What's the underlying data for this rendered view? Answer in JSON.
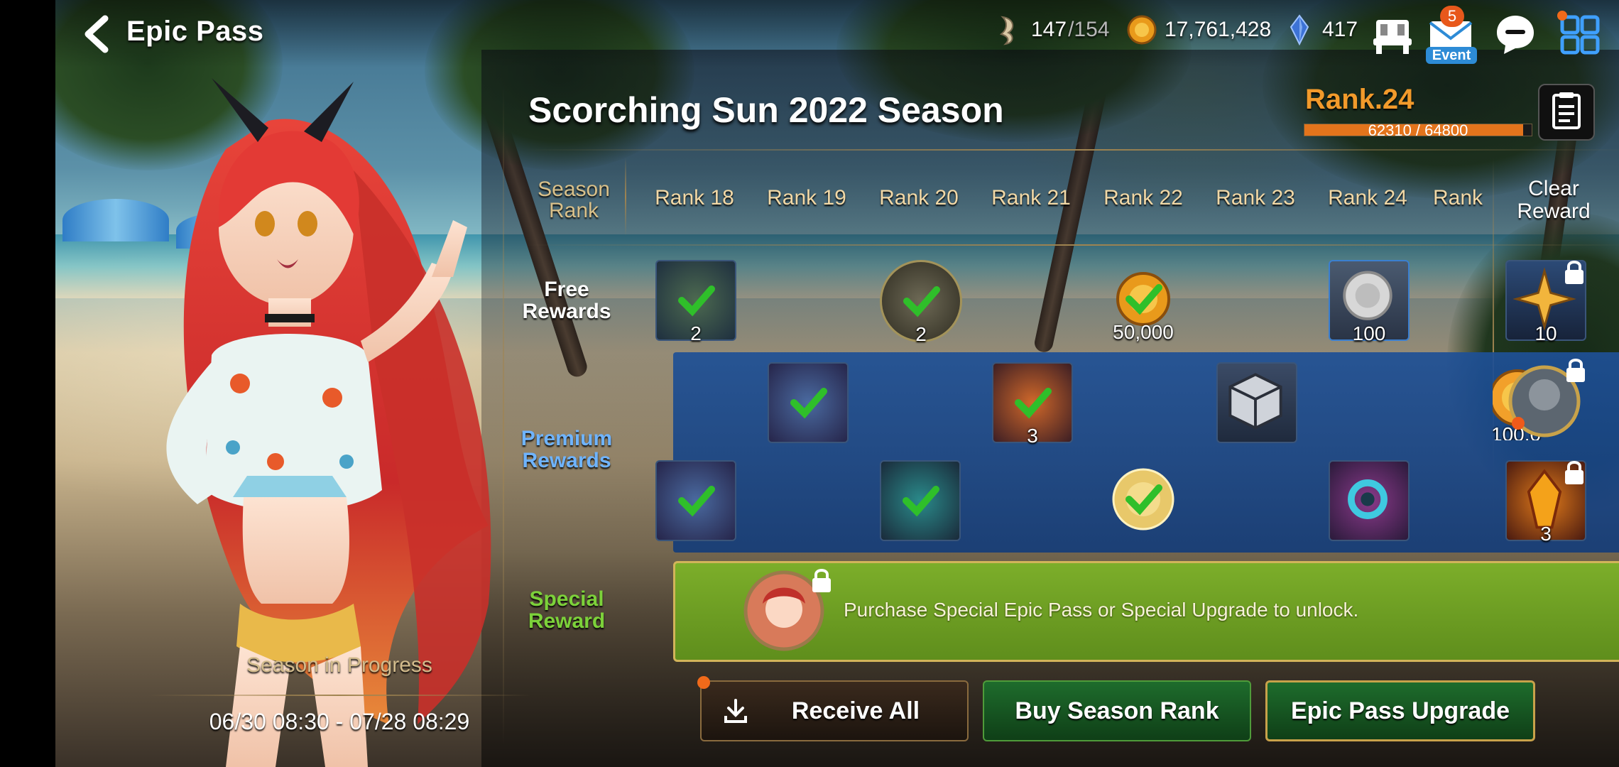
{
  "window": {
    "title": "Epic Pass"
  },
  "currencies": {
    "stamina_current": "147",
    "stamina_max": "/154",
    "gold": "17,761,428",
    "crystals": "417"
  },
  "topbar": {
    "event_badge": "5",
    "event_label": "Event"
  },
  "season": {
    "title": "Scorching Sun 2022 Season",
    "rank_label": "Rank.24",
    "rank_progress_text": "62310 / 64800",
    "rank_progress": 0.9616,
    "status": "Season in Progress",
    "dates": "06/30 08:30 - 07/28 08:29"
  },
  "table": {
    "season_rank_header": "Season Rank",
    "clear_reward_header": "Clear Reward",
    "ranks": [
      "Rank 18",
      "Rank 19",
      "Rank 20",
      "Rank 21",
      "Rank 22",
      "Rank 23",
      "Rank 24",
      "Rank"
    ],
    "free_label": "Free Rewards",
    "premium_label": "Premium Rewards",
    "special_label": "Special Reward",
    "free_counts": {
      "r18": "2",
      "r20": "2",
      "r22": "50,000",
      "r24": "100",
      "clear": "10"
    },
    "premium_counts": {
      "r21": "3",
      "r25": "100,0",
      "clear": "3"
    },
    "special_message": "Purchase Special Epic Pass or Special Upgrade to unlock."
  },
  "buttons": {
    "receive_all": "Receive All",
    "buy_season_rank": "Buy Season Rank",
    "epic_pass_upgrade": "Epic Pass Upgrade"
  },
  "colors": {
    "accent_orange": "#f29a2b",
    "premium_blue": "#6fb4ff",
    "special_green": "#7cd13a",
    "check_green": "#2fbf2a"
  }
}
